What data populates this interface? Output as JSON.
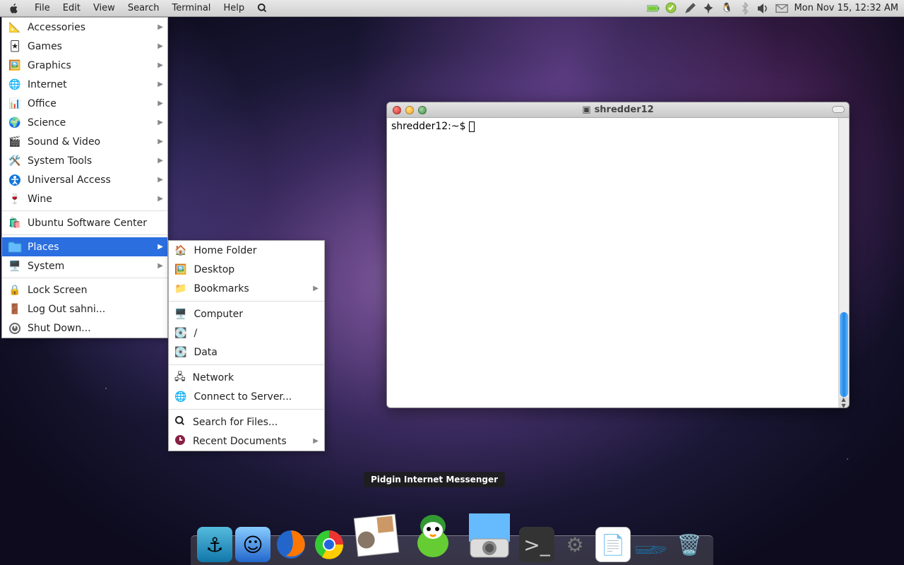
{
  "menubar": {
    "items": [
      "File",
      "Edit",
      "View",
      "Search",
      "Terminal",
      "Help"
    ],
    "clock": "Mon Nov 15, 12:32 AM"
  },
  "appmenu": {
    "categories": [
      {
        "label": "Accessories",
        "submenu": true,
        "icon": "accessories"
      },
      {
        "label": "Games",
        "submenu": true,
        "icon": "games"
      },
      {
        "label": "Graphics",
        "submenu": true,
        "icon": "graphics"
      },
      {
        "label": "Internet",
        "submenu": true,
        "icon": "internet"
      },
      {
        "label": "Office",
        "submenu": true,
        "icon": "office"
      },
      {
        "label": "Science",
        "submenu": true,
        "icon": "science"
      },
      {
        "label": "Sound & Video",
        "submenu": true,
        "icon": "soundvideo"
      },
      {
        "label": "System Tools",
        "submenu": true,
        "icon": "systemtools"
      },
      {
        "label": "Universal Access",
        "submenu": true,
        "icon": "access"
      },
      {
        "label": "Wine",
        "submenu": true,
        "icon": "wine"
      }
    ],
    "software_center": "Ubuntu Software Center",
    "places_label": "Places",
    "system_label": "System",
    "lock": "Lock Screen",
    "logout": "Log Out sahni...",
    "shutdown": "Shut Down..."
  },
  "places_submenu": {
    "home": "Home Folder",
    "desktop": "Desktop",
    "bookmarks": "Bookmarks",
    "computer": "Computer",
    "root": "/",
    "data": "Data",
    "network": "Network",
    "connect": "Connect to Server...",
    "search": "Search for Files...",
    "recent": "Recent Documents"
  },
  "terminal": {
    "title": "shredder12",
    "prompt": "shredder12:~$ "
  },
  "dock": {
    "tooltip": "Pidgin Internet Messenger",
    "items": [
      "anchor",
      "finder",
      "firefox",
      "chrome",
      "mail",
      "pidgin",
      "camera",
      "terminal",
      "settings",
      "editor",
      "feather",
      "trash"
    ]
  }
}
